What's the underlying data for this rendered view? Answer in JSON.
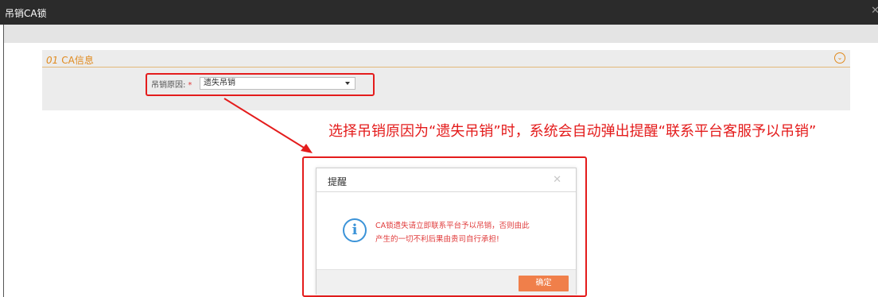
{
  "window": {
    "title": "吊销CA锁",
    "close_icon": "close-icon"
  },
  "section": {
    "number": "01",
    "title": "CA信息",
    "collapse_icon": "chevron-down-circle-icon"
  },
  "form": {
    "reason_label": "吊销原因:",
    "required_mark": "*",
    "reason_value": "遗失吊销"
  },
  "annotation": {
    "text": "选择吊销原因为“遗失吊销”时，系统会自动弹出提醒“联系平台客服予以吊销”",
    "highlight_color": "#e41c1c"
  },
  "dialog": {
    "title": "提醒",
    "close_icon": "close-icon",
    "info_icon": "info-icon",
    "message_line1": "CA锁遗失请立即联系平台予以吊销，否则由此",
    "message_line2": "产生的一切不利后果由贵司自行承担!",
    "ok_label": "确定"
  },
  "colors": {
    "accent": "#e08a1e",
    "button": "#f07f4a",
    "info": "#3b93d8"
  }
}
